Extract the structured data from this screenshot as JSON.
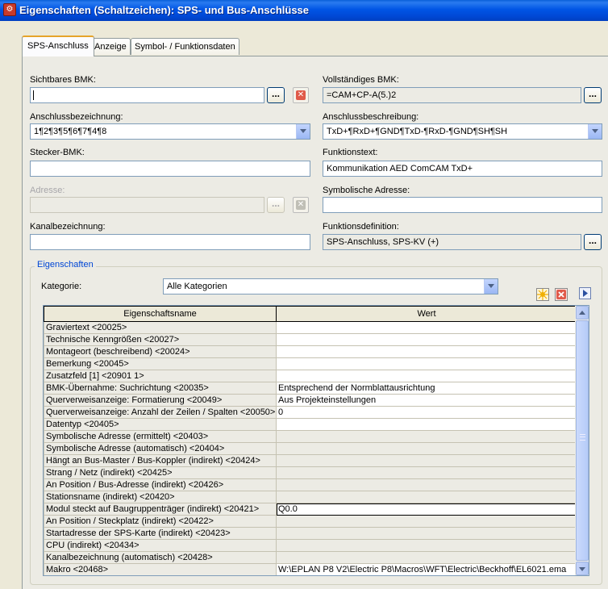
{
  "window": {
    "title": "Eigenschaften (Schaltzeichen): SPS- und Bus-Anschlüsse",
    "icon": "eplan-app-icon"
  },
  "tabs": [
    {
      "label": "SPS-Anschluss",
      "active": true
    },
    {
      "label": "Anzeige",
      "active": false
    },
    {
      "label": "Symbol- / Funktionsdaten",
      "active": false
    }
  ],
  "form": {
    "sichtbares_bmk": {
      "label": "Sichtbares BMK:",
      "value": ""
    },
    "vollstaendiges_bmk": {
      "label": "Vollständiges BMK:",
      "value": "=CAM+CP-A(5.)2"
    },
    "anschlussbezeichnung": {
      "label": "Anschlussbezeichnung:",
      "value": "1¶2¶3¶5¶6¶7¶4¶8"
    },
    "anschlussbeschreibung": {
      "label": "Anschlussbeschreibung:",
      "value": "TxD+¶RxD+¶GND¶TxD-¶RxD-¶GND¶SH¶SH"
    },
    "stecker_bmk": {
      "label": "Stecker-BMK:",
      "value": ""
    },
    "funktionstext": {
      "label": "Funktionstext:",
      "value": "Kommunikation AED ComCAM TxD+"
    },
    "adresse": {
      "label": "Adresse:",
      "value": "",
      "disabled": true
    },
    "symbolische_adresse": {
      "label": "Symbolische Adresse:",
      "value": ""
    },
    "kanalbezeichnung": {
      "label": "Kanalbezeichnung:",
      "value": ""
    },
    "funktionsdefinition": {
      "label": "Funktionsdefinition:",
      "value": "SPS-Anschluss, SPS-KV (+)"
    },
    "ellipsis_label": "...",
    "delete_label": "✕"
  },
  "eigenschaften": {
    "title": "Eigenschaften",
    "kategorie_label": "Kategorie:",
    "kategorie_value": "Alle Kategorien",
    "columns": [
      "Eigenschaftsname",
      "Wert"
    ],
    "rows": [
      {
        "name": "Graviertext <20025>",
        "value": ""
      },
      {
        "name": "Technische Kenngrößen <20027>",
        "value": ""
      },
      {
        "name": "Montageort (beschreibend) <20024>",
        "value": ""
      },
      {
        "name": "Bemerkung <20045>",
        "value": ""
      },
      {
        "name": "Zusatzfeld [1] <20901 1>",
        "value": ""
      },
      {
        "name": "BMK-Übernahme: Suchrichtung <20035>",
        "value": "Entsprechend der Normblattausrichtung"
      },
      {
        "name": "Querverweisanzeige: Formatierung <20049>",
        "value": "Aus Projekteinstellungen"
      },
      {
        "name": "Querverweisanzeige: Anzahl der Zeilen / Spalten <20050>",
        "value": "0"
      },
      {
        "name": "Datentyp <20405>",
        "value": ""
      },
      {
        "name": "Symbolische Adresse (ermittelt) <20403>",
        "value": ""
      },
      {
        "name": "Symbolische Adresse (automatisch) <20404>",
        "value": ""
      },
      {
        "name": "Hängt an Bus-Master / Bus-Koppler (indirekt) <20424>",
        "value": ""
      },
      {
        "name": "Strang / Netz (indirekt) <20425>",
        "value": ""
      },
      {
        "name": "An Position / Bus-Adresse (indirekt) <20426>",
        "value": ""
      },
      {
        "name": "Stationsname (indirekt) <20420>",
        "value": ""
      },
      {
        "name": "Modul steckt auf Baugruppenträger (indirekt) <20421>",
        "value": "Q0.0"
      },
      {
        "name": "An Position / Steckplatz (indirekt) <20422>",
        "value": ""
      },
      {
        "name": "Startadresse der SPS-Karte (indirekt) <20423>",
        "value": ""
      },
      {
        "name": "CPU (indirekt) <20434>",
        "value": ""
      },
      {
        "name": "Kanalbezeichnung (automatisch) <20428>",
        "value": ""
      },
      {
        "name": "Makro <20468>",
        "value": "W:\\EPLAN P8 V2\\Electric P8\\Macros\\WFT\\Electric\\Beckhoff\\EL6021.ema"
      }
    ]
  }
}
